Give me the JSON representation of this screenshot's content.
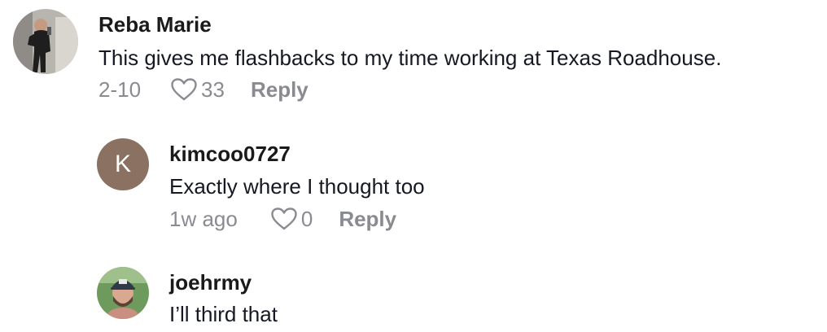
{
  "comments": [
    {
      "username": "Reba Marie",
      "text": "This gives me flashbacks to my time working at Texas Roadhouse.",
      "date": "2-10",
      "likes": "33",
      "reply_label": "Reply",
      "avatar": "photo"
    },
    {
      "username": "kimcoo0727",
      "text": "Exactly where I thought too",
      "date": "1w ago",
      "likes": "0",
      "reply_label": "Reply",
      "avatar_letter": "K",
      "avatar_color": "#8a7162"
    },
    {
      "username": "joehrmy",
      "text": "I’ll third that",
      "avatar": "photo"
    }
  ],
  "colors": {
    "meta_gray": "#8a8b91",
    "text": "#161823"
  },
  "icons": [
    "heart-outline-icon"
  ]
}
